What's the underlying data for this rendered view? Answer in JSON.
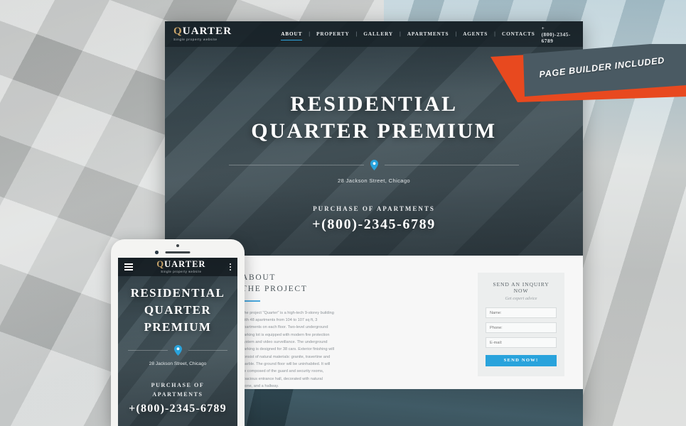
{
  "background": {
    "alt": "modern apartment building facade"
  },
  "ribbon": {
    "label": "PAGE BUILDER INCLUDED",
    "banner_color": "#4a5a63",
    "arrow_color": "#e8491f"
  },
  "desktop": {
    "header": {
      "logo": {
        "first_letter": "Q",
        "rest": "UARTER",
        "tagline": "Single property website"
      },
      "nav": [
        {
          "label": "ABOUT",
          "active": true
        },
        {
          "label": "PROPERTY",
          "active": false
        },
        {
          "label": "GALLERY",
          "active": false
        },
        {
          "label": "APARTMENTS",
          "active": false
        },
        {
          "label": "AGENTS",
          "active": false
        },
        {
          "label": "CONTACTS",
          "active": false
        }
      ],
      "separator": "|",
      "phone": "+(800)-2345-6789"
    },
    "hero": {
      "title_line1": "RESIDENTIAL",
      "title_line2": "QUARTER PREMIUM",
      "pin_icon": "map-pin-icon",
      "address": "28 Jackson Street, Chicago",
      "cta_label": "PURCHASE OF APARTMENTS",
      "cta_phone": "+(800)-2345-6789",
      "accent_color": "#29a3dc"
    },
    "about": {
      "kicker": "ABOUT",
      "heading": "THE PROJECT",
      "body": "The project \"Quarter\" is a high-tech 9-storey building with 48 apartments from 104 to 107 sq ft, 3 apartments on each floor. Two-level underground parking lot is equipped with modern fire protection system and video surveillance. The underground parking is designed for 38 cars. Exterior finishing will consist of natural materials: granite, travertine and marble. The ground floor will be uninhabited. It will be composed of the guard and security rooms, spacious entrance hall, decorated with natural stone, and a hallway."
    },
    "inquiry": {
      "title": "SEND AN INQUIRY NOW",
      "subtitle": "Get expert advice",
      "fields": [
        {
          "name": "name-field",
          "placeholder": "Name:"
        },
        {
          "name": "phone-field",
          "placeholder": "Phone:"
        },
        {
          "name": "email-field",
          "placeholder": "E-mail:"
        }
      ],
      "submit_label": "SEND NOW!",
      "submit_color": "#29a3dc"
    }
  },
  "mobile": {
    "header": {
      "menu_icon": "hamburger-menu-icon",
      "logo": {
        "first_letter": "Q",
        "rest": "UARTER",
        "tagline": "Single property website"
      },
      "options_icon": "kebab-menu-icon"
    },
    "hero": {
      "title_line1": "RESIDENTIAL",
      "title_line2": "QUARTER",
      "title_line3": "PREMIUM",
      "pin_icon": "map-pin-icon",
      "address": "28 Jackson Street, Chicago",
      "cta_label_line1": "PURCHASE OF",
      "cta_label_line2": "APARTMENTS",
      "cta_phone": "+(800)-2345-6789"
    }
  }
}
